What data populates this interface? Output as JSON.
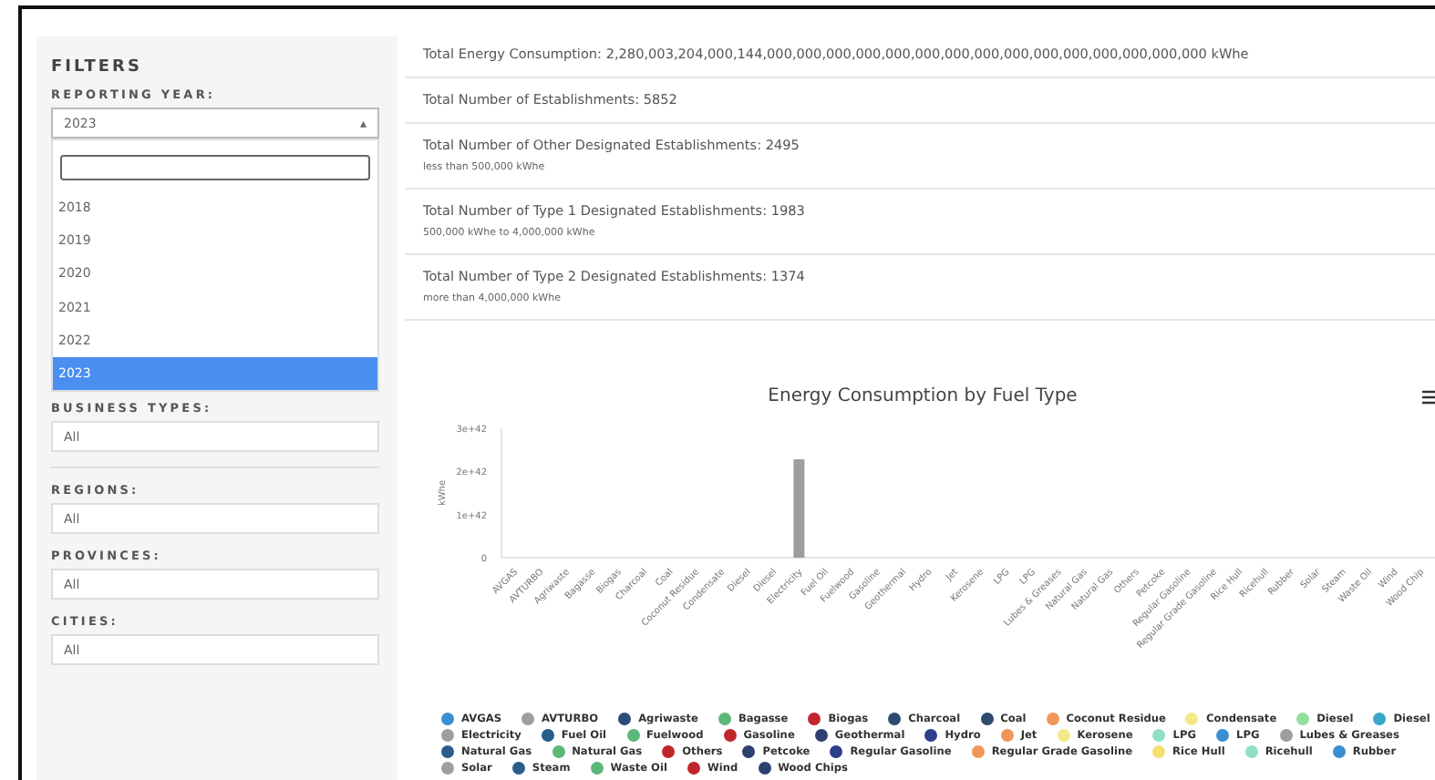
{
  "sidebar": {
    "title": "FILTERS",
    "filters": [
      {
        "label": "REPORTING YEAR:",
        "value": "2023",
        "caret": "▴",
        "open": true,
        "options": [
          {
            "label": "2018",
            "selected": false
          },
          {
            "label": "2019",
            "selected": false
          },
          {
            "label": "2020",
            "selected": false
          },
          {
            "label": "2021",
            "selected": false
          },
          {
            "label": "2022",
            "selected": false
          },
          {
            "label": "2023",
            "selected": true
          }
        ]
      },
      {
        "label": "BUSINESS TYPES:",
        "value": "All",
        "open": false
      },
      {
        "label": "REGIONS:",
        "value": "All",
        "open": false
      },
      {
        "label": "PROVINCES:",
        "value": "All",
        "open": false
      },
      {
        "label": "CITIES:",
        "value": "All",
        "open": false
      }
    ]
  },
  "stats": [
    {
      "text": "Total Energy Consumption: 2,280,003,204,000,144,000,000,000,000,000,000,000,000,000,000,000,000,000,000,000 kWhe"
    },
    {
      "text": "Total Number of Establishments: 5852"
    },
    {
      "text": "Total Number of Other Designated Establishments: 2495",
      "note": "less than 500,000 kWhe"
    },
    {
      "text": "Total Number of Type 1 Designated Establishments: 1983",
      "note": "500,000 kWhe to 4,000,000 kWhe"
    },
    {
      "text": "Total Number of Type 2 Designated Establishments: 1374",
      "note": "more than 4,000,000 kWhe"
    }
  ],
  "chart": {
    "chart_data": {
      "type": "bar",
      "title": "Energy Consumption by Fuel Type",
      "ylabel": "kWhe",
      "categories": [
        "AVGAS",
        "AVTURBO",
        "Agriwaste",
        "Bagasse",
        "Biogas",
        "Charcoal",
        "Coal",
        "Coconut Residue",
        "Condensate",
        "Diesel",
        "Diesel",
        "Electricity",
        "Fuel Oil",
        "Fuelwood",
        "Gasoline",
        "Geothermal",
        "Hydro",
        "Jet",
        "Kerosene",
        "LPG",
        "LPG",
        "Lubes & Greases",
        "Natural Gas",
        "Natural Gas",
        "Others",
        "Petcoke",
        "Regular Gasoline",
        "Regular Grade Gasoline",
        "Rice Hull",
        "Ricehull",
        "Rubber",
        "Solar",
        "Steam",
        "Waste Oil",
        "Wind",
        "Wood Chip"
      ],
      "values": [
        0,
        0,
        0,
        0,
        0,
        0,
        0,
        0,
        0,
        0,
        0,
        2.28e+42,
        0,
        0,
        0,
        0,
        0,
        0,
        0,
        0,
        0,
        0,
        0,
        0,
        0,
        0,
        0,
        0,
        0,
        0,
        0,
        0,
        0,
        0,
        0,
        0
      ],
      "ylim": [
        0,
        3e+42
      ],
      "yticks": [
        {
          "value": 0,
          "label": "0"
        },
        {
          "value": 1e+42,
          "label": "1e+42"
        },
        {
          "value": 2e+42,
          "label": "2e+42"
        },
        {
          "value": 3e+42,
          "label": "3e+42"
        }
      ]
    },
    "legend": [
      {
        "label": "AVGAS",
        "color": "#3b8fd0"
      },
      {
        "label": "AVTURBO",
        "color": "#9e9e9e"
      },
      {
        "label": "Agriwaste",
        "color": "#2c4a7a"
      },
      {
        "label": "Bagasse",
        "color": "#5cb87a"
      },
      {
        "label": "Biogas",
        "color": "#c0272d"
      },
      {
        "label": "Charcoal",
        "color": "#2e4a70"
      },
      {
        "label": "Coal",
        "color": "#2e4a70"
      },
      {
        "label": "Coconut Residue",
        "color": "#f0965a"
      },
      {
        "label": "Condensate",
        "color": "#f5e88a"
      },
      {
        "label": "Diesel",
        "color": "#90e0a0"
      },
      {
        "label": "Diesel",
        "color": "#3aa8c8"
      },
      {
        "label": "Electricity",
        "color": "#9e9e9e"
      },
      {
        "label": "Fuel Oil",
        "color": "#2a5d8c"
      },
      {
        "label": "Fuelwood",
        "color": "#5cb87a"
      },
      {
        "label": "Gasoline",
        "color": "#c0272d"
      },
      {
        "label": "Geothermal",
        "color": "#2e4070"
      },
      {
        "label": "Hydro",
        "color": "#2e3f8a"
      },
      {
        "label": "Jet",
        "color": "#f0965a"
      },
      {
        "label": "Kerosene",
        "color": "#f5e88a"
      },
      {
        "label": "LPG",
        "color": "#90e0c8"
      },
      {
        "label": "LPG",
        "color": "#3b8fd0"
      },
      {
        "label": "Lubes & Greases",
        "color": "#9e9e9e"
      },
      {
        "label": "Natural Gas",
        "color": "#2a5d8c"
      },
      {
        "label": "Natural Gas",
        "color": "#5cb87a"
      },
      {
        "label": "Others",
        "color": "#c0272d"
      },
      {
        "label": "Petcoke",
        "color": "#2e4070"
      },
      {
        "label": "Regular Gasoline",
        "color": "#2e3f8a"
      },
      {
        "label": "Regular Grade Gasoline",
        "color": "#f0965a"
      },
      {
        "label": "Rice Hull",
        "color": "#f5e070"
      },
      {
        "label": "Ricehull",
        "color": "#90e0c8"
      },
      {
        "label": "Rubber",
        "color": "#3b8fd0"
      },
      {
        "label": "Solar",
        "color": "#9e9e9e"
      },
      {
        "label": "Steam",
        "color": "#2a5d8c"
      },
      {
        "label": "Waste Oil",
        "color": "#5cb87a"
      },
      {
        "label": "Wind",
        "color": "#c0272d"
      },
      {
        "label": "Wood Chips",
        "color": "#2e4070"
      }
    ]
  }
}
